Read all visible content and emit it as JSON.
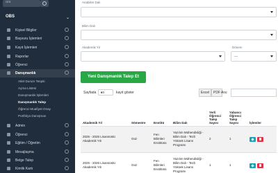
{
  "sidebar": {
    "search_placeholder": "ara",
    "section_title": "OBS",
    "items_top": [
      {
        "label": "Kişisel Bilgiler",
        "icon": "user-icon"
      },
      {
        "label": "Başvuru İşlemleri",
        "icon": "folder-icon"
      },
      {
        "label": "Kayıt İşlemleri",
        "icon": "edit-icon"
      },
      {
        "label": "Raporlar",
        "icon": "chart-icon"
      },
      {
        "label": "Öğrenci",
        "icon": "student-icon"
      },
      {
        "label": "Danışmanlık",
        "icon": "users-icon"
      }
    ],
    "sub_items": [
      {
        "label": "Atlet Durum Tespiti"
      },
      {
        "label": "Açma Listesi"
      },
      {
        "label": "Danışmanlık İşlemleri"
      },
      {
        "label": "Danışmanlık Talep"
      },
      {
        "label": "Öğrenci Muafiyet Onay"
      },
      {
        "label": "Portfolyo Danışman"
      }
    ],
    "items_bottom": [
      {
        "label": "Admin",
        "icon": "admin-icon"
      },
      {
        "label": "Öğrenci",
        "icon": "student-icon"
      },
      {
        "label": "Eğitim / Öğretim",
        "icon": "book-icon"
      },
      {
        "label": "Mesajlaşma",
        "icon": "message-icon"
      },
      {
        "label": "Belge Talep",
        "icon": "document-icon"
      },
      {
        "label": "Kimlik Kartı",
        "icon": "card-icon"
      }
    ]
  },
  "form": {
    "anabilim_label": "Anabilim Dalı",
    "bilim_label": "Bilim Dalı",
    "akademik_yil_label": "Akademik Yıl",
    "donem_label": "Dönem",
    "anabilim_value": "",
    "bilim_value": "",
    "akademik_yil_value": "",
    "donem_value": "---"
  },
  "new_request_button": "Yeni Danışmanlık Talep Et",
  "list_controls": {
    "showing_prefix": "Sayfada",
    "page_size": "10",
    "showing_suffix": "kayıt göster",
    "excel": "Excel",
    "pdf": "PDF",
    "search_label": "Ara:"
  },
  "table": {
    "headers": [
      "Akademik Yıl",
      "Sömestre",
      "Enstitü",
      "Bilim Dalı",
      "Yerli Öğrenci Talep Sayısı",
      "Yabancı Öğrenci Talep Sayısı",
      "İşlemler"
    ],
    "rows": [
      [
        "2025 - 2026 Lisansüstü Akademik Yılı",
        "Güz",
        "Fen Bilimleri Enstitüsü",
        "Yazılım Mühendisliği - Bilim Dalı - Tezli Yüksek Lisans Programı",
        "2",
        "1"
      ],
      [
        "2025 - 2026 Lisansüstü Akademik Yılı",
        "Güz",
        "Fen Bilimleri Enstitüsü",
        "Yazılım Mühendisliği - Bilim Dalı - Tezli Yüksek Lisans Programı",
        "1",
        "1"
      ]
    ]
  }
}
